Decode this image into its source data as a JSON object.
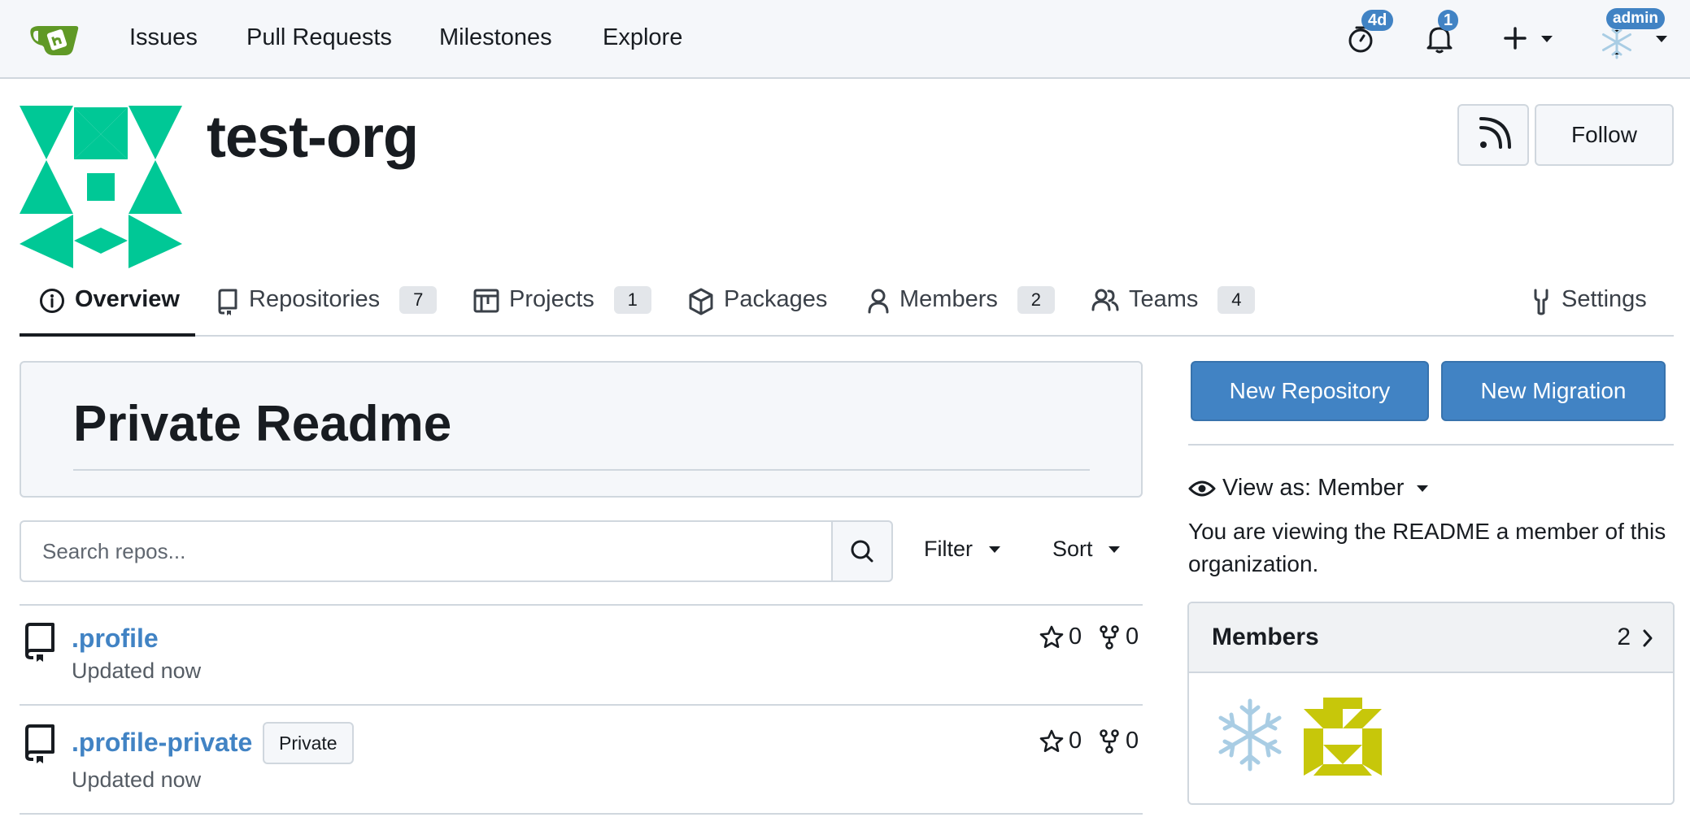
{
  "navbar": {
    "links": [
      "Issues",
      "Pull Requests",
      "Milestones",
      "Explore"
    ],
    "stopwatch_badge": "4d",
    "notifications_badge": "1",
    "user_badge": "admin"
  },
  "org": {
    "name": "test-org",
    "follow_label": "Follow",
    "avatar_color": "#00c896"
  },
  "tabs": [
    {
      "label": "Overview",
      "icon": "info-icon",
      "active": true
    },
    {
      "label": "Repositories",
      "icon": "repo-icon",
      "count": "7"
    },
    {
      "label": "Projects",
      "icon": "project-icon",
      "count": "1"
    },
    {
      "label": "Packages",
      "icon": "package-icon"
    },
    {
      "label": "Members",
      "icon": "person-icon",
      "count": "2"
    },
    {
      "label": "Teams",
      "icon": "people-icon",
      "count": "4"
    },
    {
      "label": "Settings",
      "icon": "tools-icon"
    }
  ],
  "readme": {
    "title": "Private Readme"
  },
  "search": {
    "placeholder": "Search repos...",
    "filter_label": "Filter",
    "sort_label": "Sort"
  },
  "repos": [
    {
      "name": ".profile",
      "updated": "Updated now",
      "stars": "0",
      "forks": "0"
    },
    {
      "name": ".profile-private",
      "updated": "Updated now",
      "stars": "0",
      "forks": "0",
      "badge": "Private"
    }
  ],
  "sidebar": {
    "new_repo_label": "New Repository",
    "new_migration_label": "New Migration",
    "view_as_prefix": "View as:",
    "view_as_value": "Member",
    "view_desc": "You are viewing the README a member of this organization.",
    "members_title": "Members",
    "members_count": "2"
  },
  "colors": {
    "accent": "#4183c4",
    "org_avatar": "#00c896",
    "member_avatar": "#c7c70a"
  }
}
